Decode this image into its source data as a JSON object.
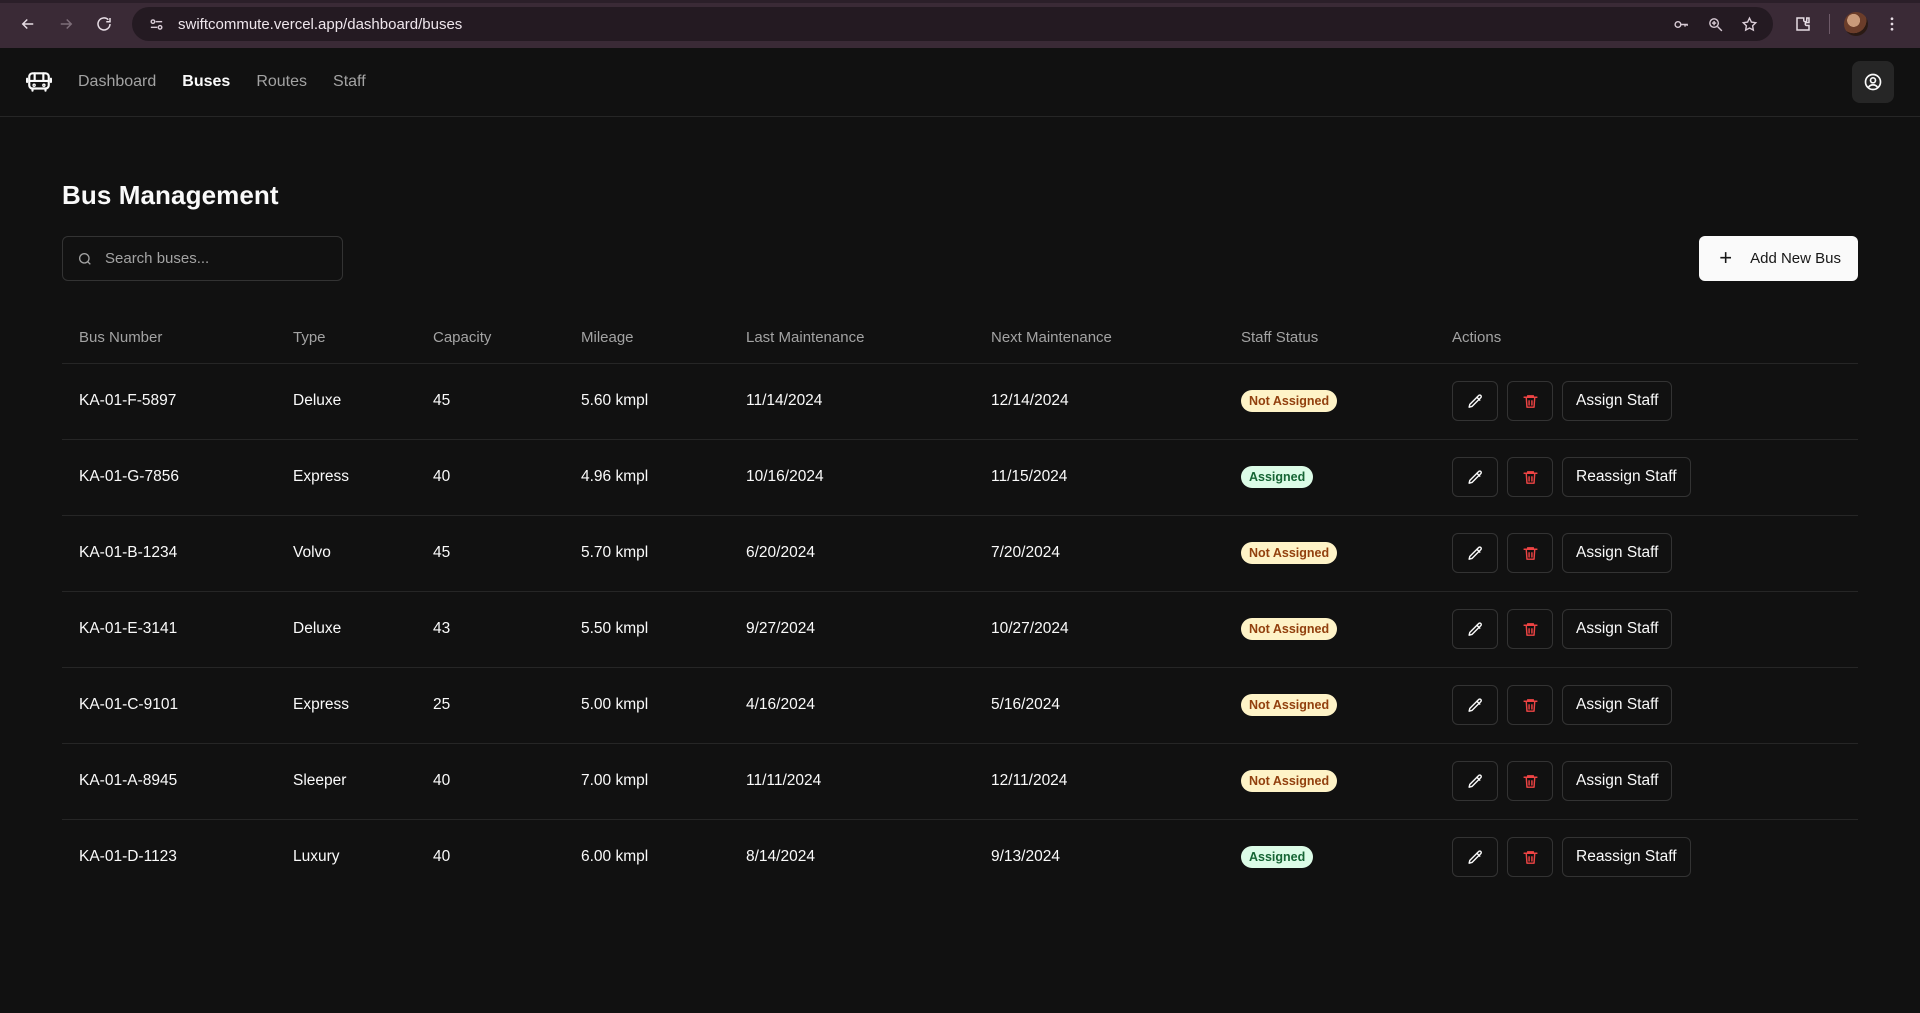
{
  "browser": {
    "url": "swiftcommute.vercel.app/dashboard/buses"
  },
  "nav": {
    "items": [
      {
        "label": "Dashboard",
        "active": false
      },
      {
        "label": "Buses",
        "active": true
      },
      {
        "label": "Routes",
        "active": false
      },
      {
        "label": "Staff",
        "active": false
      }
    ]
  },
  "page": {
    "title": "Bus Management",
    "search_placeholder": "Search buses...",
    "add_label": "Add New Bus"
  },
  "table": {
    "headers": [
      "Bus Number",
      "Type",
      "Capacity",
      "Mileage",
      "Last Maintenance",
      "Next Maintenance",
      "Staff Status",
      "Actions"
    ],
    "rows": [
      {
        "bus": "KA-01-F-5897",
        "type": "Deluxe",
        "capacity": "45",
        "mileage": "5.60 kmpl",
        "last": "11/14/2024",
        "next": "12/14/2024",
        "status": "Not Assigned",
        "assigned": false,
        "action": "Assign Staff"
      },
      {
        "bus": "KA-01-G-7856",
        "type": "Express",
        "capacity": "40",
        "mileage": "4.96 kmpl",
        "last": "10/16/2024",
        "next": "11/15/2024",
        "status": "Assigned",
        "assigned": true,
        "action": "Reassign Staff"
      },
      {
        "bus": "KA-01-B-1234",
        "type": "Volvo",
        "capacity": "45",
        "mileage": "5.70 kmpl",
        "last": "6/20/2024",
        "next": "7/20/2024",
        "status": "Not Assigned",
        "assigned": false,
        "action": "Assign Staff"
      },
      {
        "bus": "KA-01-E-3141",
        "type": "Deluxe",
        "capacity": "43",
        "mileage": "5.50 kmpl",
        "last": "9/27/2024",
        "next": "10/27/2024",
        "status": "Not Assigned",
        "assigned": false,
        "action": "Assign Staff"
      },
      {
        "bus": "KA-01-C-9101",
        "type": "Express",
        "capacity": "25",
        "mileage": "5.00 kmpl",
        "last": "4/16/2024",
        "next": "5/16/2024",
        "status": "Not Assigned",
        "assigned": false,
        "action": "Assign Staff"
      },
      {
        "bus": "KA-01-A-8945",
        "type": "Sleeper",
        "capacity": "40",
        "mileage": "7.00 kmpl",
        "last": "11/11/2024",
        "next": "12/11/2024",
        "status": "Not Assigned",
        "assigned": false,
        "action": "Assign Staff"
      },
      {
        "bus": "KA-01-D-1123",
        "type": "Luxury",
        "capacity": "40",
        "mileage": "6.00 kmpl",
        "last": "8/14/2024",
        "next": "9/13/2024",
        "status": "Assigned",
        "assigned": true,
        "action": "Reassign Staff"
      }
    ]
  },
  "colors": {
    "background": "#111111",
    "not_assigned_bg": "#fef3c7",
    "assigned_bg": "#dcfce7",
    "delete": "#ef4444"
  }
}
